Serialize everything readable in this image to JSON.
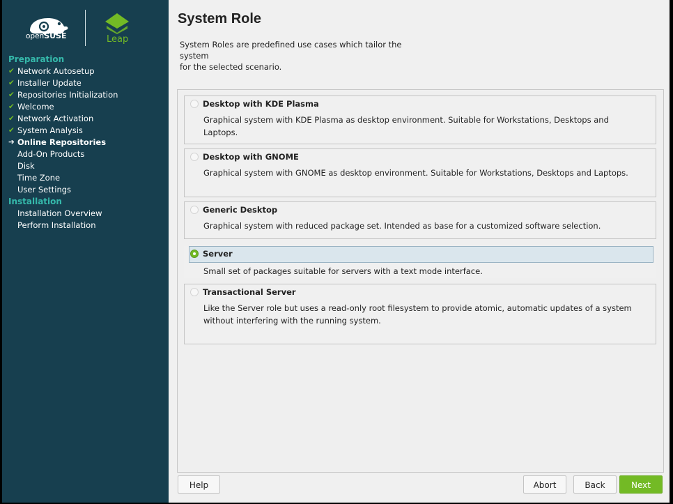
{
  "sidebar": {
    "brand": {
      "open": "open",
      "suse": "SUSE",
      "leap": "Leap"
    },
    "sections": [
      {
        "title": "Preparation",
        "steps": [
          {
            "label": "Network Autosetup",
            "state": "done"
          },
          {
            "label": "Installer Update",
            "state": "done"
          },
          {
            "label": "Repositories Initialization",
            "state": "done"
          },
          {
            "label": "Welcome",
            "state": "done"
          },
          {
            "label": "Network Activation",
            "state": "done"
          },
          {
            "label": "System Analysis",
            "state": "done"
          },
          {
            "label": "Online Repositories",
            "state": "current"
          },
          {
            "label": "Add-On Products",
            "state": "pending"
          },
          {
            "label": "Disk",
            "state": "pending"
          },
          {
            "label": "Time Zone",
            "state": "pending"
          },
          {
            "label": "User Settings",
            "state": "pending"
          }
        ]
      },
      {
        "title": "Installation",
        "steps": [
          {
            "label": "Installation Overview",
            "state": "pending"
          },
          {
            "label": "Perform Installation",
            "state": "pending"
          }
        ]
      }
    ],
    "marks": {
      "done": "✔",
      "current": "➔"
    }
  },
  "main": {
    "title": "System Role",
    "description_line1": "System Roles are predefined use cases which tailor the system",
    "description_line2": "for the selected scenario.",
    "roles": [
      {
        "name": "Desktop with KDE Plasma",
        "description": "Graphical system with KDE Plasma as desktop environment. Suitable for Workstations, Desktops and Laptops.",
        "selected": false
      },
      {
        "name": "Desktop with GNOME",
        "description": "Graphical system with GNOME as desktop environment. Suitable for Workstations, Desktops and Laptops.",
        "selected": false
      },
      {
        "name": "Generic Desktop",
        "description": "Graphical system with reduced package set. Intended as base for a customized software selection.",
        "selected": false
      },
      {
        "name": "Server",
        "description": "Small set of packages suitable for servers with a text mode interface.",
        "selected": true
      },
      {
        "name": "Transactional Server",
        "description_line1": "Like the Server role but uses a read-only root filesystem to provide atomic, automatic updates of a system",
        "description_line2": "without interfering with the running system.",
        "selected": false
      }
    ]
  },
  "buttons": {
    "help": "Help",
    "abort": "Abort",
    "back": "Back",
    "next": "Next"
  },
  "colors": {
    "sidebar_bg": "#173f4f",
    "accent_green": "#73ba25",
    "section_teal": "#35b9ab"
  }
}
